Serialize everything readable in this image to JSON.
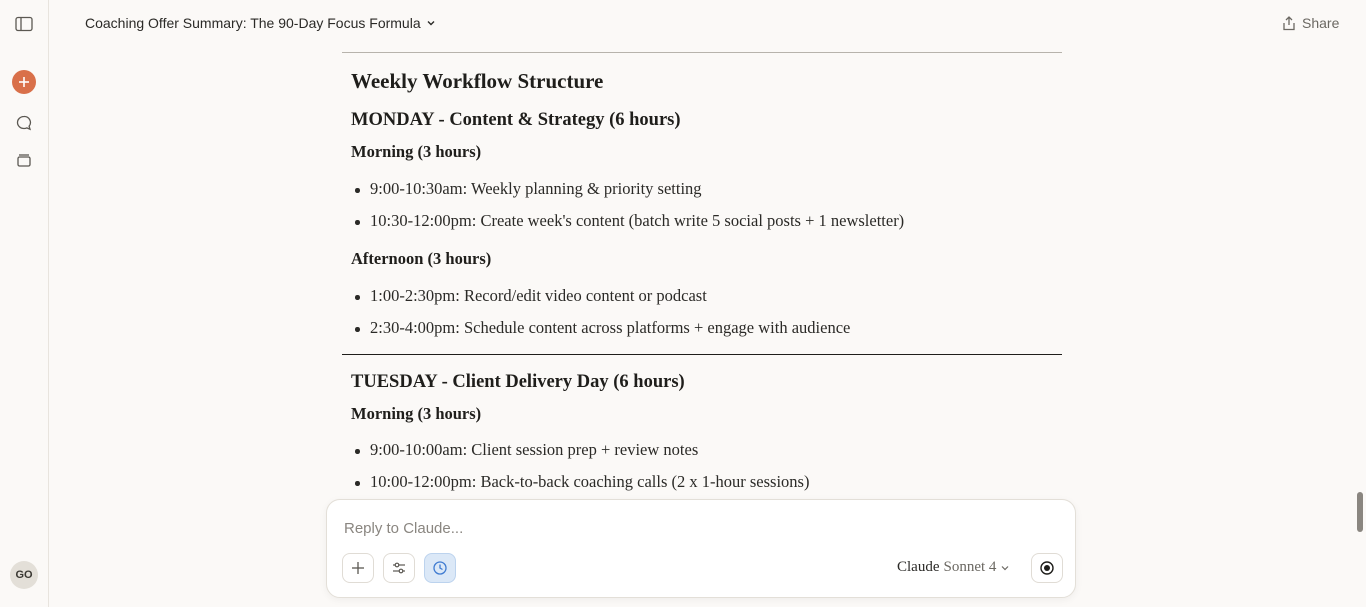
{
  "header": {
    "title": "Coaching Offer Summary: The 90-Day Focus Formula",
    "share_label": "Share"
  },
  "sidebar": {
    "icons": [
      "sidebar-toggle-icon",
      "new-chat-icon",
      "chats-icon",
      "projects-icon"
    ],
    "avatar_initials": "GO"
  },
  "content": {
    "heading": "Weekly Workflow Structure",
    "monday": {
      "title": "MONDAY - Content & Strategy (6 hours)",
      "morning_label": "Morning (3 hours)",
      "morning_items": [
        "9:00-10:30am: Weekly planning & priority setting",
        "10:30-12:00pm: Create week's content (batch write 5 social posts + 1 newsletter)"
      ],
      "afternoon_label": "Afternoon (3 hours)",
      "afternoon_items": [
        "1:00-2:30pm: Record/edit video content or podcast",
        "2:30-4:00pm: Schedule content across platforms + engage with audience"
      ]
    },
    "tuesday": {
      "title": "TUESDAY - Client Delivery Day (6 hours)",
      "morning_label": "Morning (3 hours)",
      "morning_items": [
        "9:00-10:00am: Client session prep + review notes",
        "10:00-12:00pm: Back-to-back coaching calls (2 x 1-hour sessions)"
      ]
    }
  },
  "composer": {
    "placeholder": "Reply to Claude...",
    "model_brand": "Claude",
    "model_name": "Sonnet 4"
  },
  "colors": {
    "accent": "#d9704a",
    "background": "#fbf9f7",
    "active_tool": "#dbe8f7"
  }
}
